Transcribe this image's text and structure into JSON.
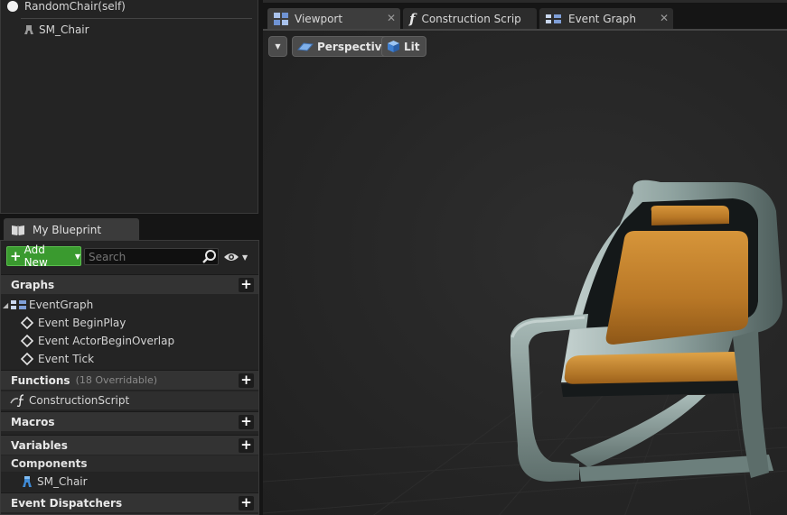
{
  "components": {
    "root": "RandomChair(self)",
    "child": "SM_Chair"
  },
  "my_blueprint": {
    "tab_label": "My Blueprint",
    "add_new_label": "Add New",
    "search_placeholder": "Search",
    "sections": {
      "graphs": {
        "title": "Graphs",
        "items": [
          {
            "label": "EventGraph"
          },
          {
            "label": "Event BeginPlay"
          },
          {
            "label": "Event ActorBeginOverlap"
          },
          {
            "label": "Event Tick"
          }
        ]
      },
      "functions": {
        "title": "Functions",
        "sub": "(18 Overridable)",
        "items": [
          {
            "label": "ConstructionScript"
          }
        ]
      },
      "macros": {
        "title": "Macros"
      },
      "variables": {
        "title": "Variables",
        "subgroup": "Components",
        "items": [
          {
            "label": "SM_Chair"
          }
        ]
      },
      "event_dispatchers": {
        "title": "Event Dispatchers"
      }
    }
  },
  "document_tabs": [
    {
      "label": "Viewport",
      "icon": "viewport-icon",
      "active": true
    },
    {
      "label": "Construction Scrip",
      "icon": "function-icon",
      "active": false
    },
    {
      "label": "Event Graph",
      "icon": "event-graph-icon",
      "active": false
    }
  ],
  "viewport": {
    "view_mode": "Perspective",
    "lighting": "Lit"
  },
  "colors": {
    "accent_green": "#3a9a2f",
    "panel_bg": "#242424",
    "viewport_bg": "#262626",
    "chair_frame": "#8fa3a0",
    "chair_cushion": "#c8862c"
  }
}
